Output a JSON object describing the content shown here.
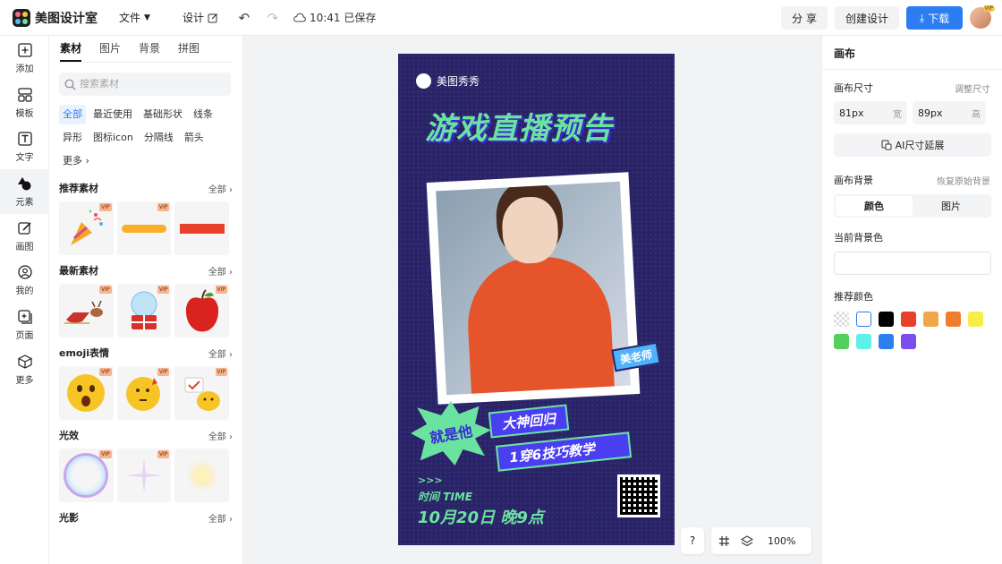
{
  "app": {
    "name": "美图设计室"
  },
  "topbar": {
    "menu_file": "文件",
    "menu_design": "设计",
    "save_status": "10:41 已保存",
    "share_label": "分 享",
    "create_label": "创建设计",
    "download_label": "下载",
    "avatar_badge": "VIP"
  },
  "leftnav": {
    "items": [
      {
        "label": "添加",
        "icon": "plus-square-icon"
      },
      {
        "label": "模板",
        "icon": "template-icon"
      },
      {
        "label": "文字",
        "icon": "text-icon"
      },
      {
        "label": "元素",
        "icon": "shapes-icon"
      },
      {
        "label": "画图",
        "icon": "draw-icon"
      },
      {
        "label": "我的",
        "icon": "user-icon"
      },
      {
        "label": "页面",
        "icon": "page-add-icon"
      },
      {
        "label": "更多",
        "icon": "cube-icon"
      }
    ],
    "active_index": 3
  },
  "panel": {
    "tabs": [
      "素材",
      "图片",
      "背景",
      "拼图"
    ],
    "active_tab": 0,
    "search_placeholder": "搜索素材",
    "chips": [
      "全部",
      "最近使用",
      "基础形状",
      "线条",
      "异形",
      "图标icon",
      "分隔线",
      "箭头",
      "更多"
    ],
    "sections": [
      {
        "title": "推荐素材",
        "more": "全部"
      },
      {
        "title": "最新素材",
        "more": "全部"
      },
      {
        "title": "emoji表情",
        "more": "全部"
      },
      {
        "title": "光效",
        "more": "全部"
      },
      {
        "title": "光影",
        "more": "全部"
      }
    ],
    "vip_badge": "VIP"
  },
  "poster": {
    "brand": "美图秀秀",
    "title": "游戏直播预告",
    "teacher_tag": "美老师",
    "burst_text": "就是他",
    "ribbon_1": "大神回归",
    "ribbon_2": "1穿6技巧教学",
    "arrows": ">>>",
    "time_label": "时间  TIME",
    "time_value": "10月20日  晚9点"
  },
  "canvas_tools": {
    "help": "?",
    "zoom": "100%"
  },
  "rpanel": {
    "title": "画布",
    "size_label": "画布尺寸",
    "resize_link": "调整尺寸",
    "width_value": "81px",
    "width_unit": "宽",
    "height_value": "89px",
    "height_unit": "高",
    "ai_btn": "AI尺寸延展",
    "bg_label": "画布背景",
    "reset_link": "恢复原始背景",
    "seg_color": "颜色",
    "seg_image": "图片",
    "current_bg_label": "当前背景色",
    "recommend_label": "推荐颜色",
    "swatches": [
      "transparent",
      "#ffffff",
      "#000000",
      "#e8402a",
      "#f2a64a",
      "#f07e2e",
      "#f6ef4a",
      "#52d15a",
      "#5ff0ec",
      "#2d7ff0",
      "#7b4ef0"
    ]
  }
}
